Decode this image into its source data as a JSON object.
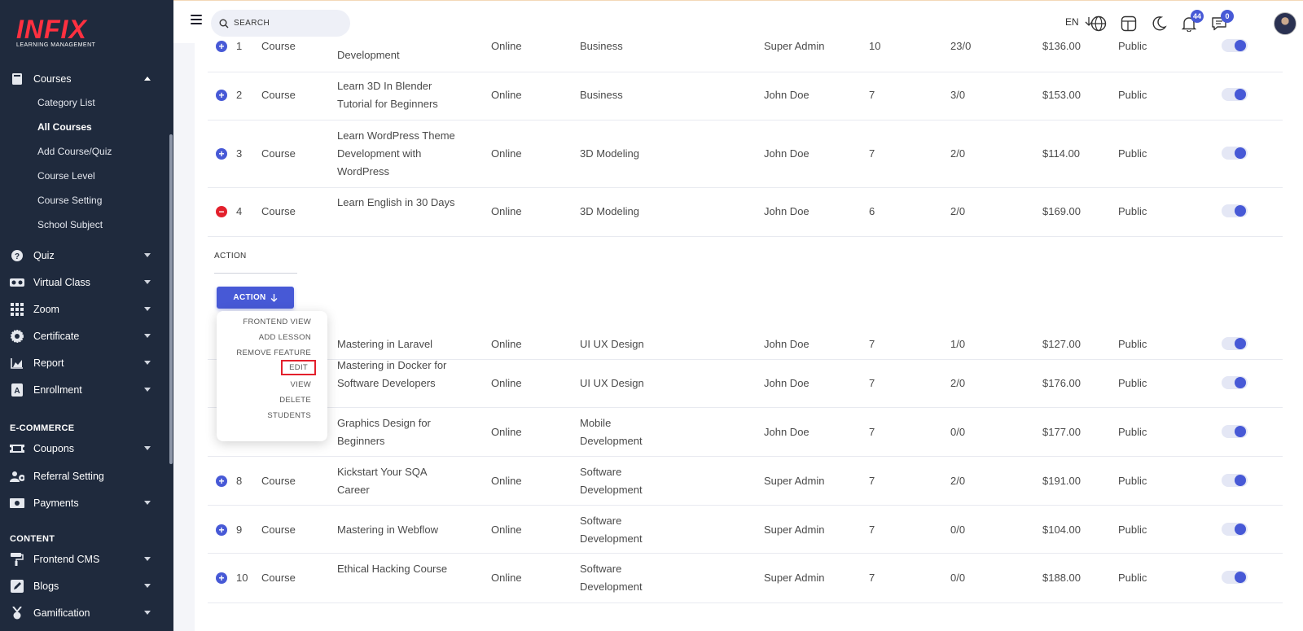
{
  "brand": {
    "logo": "INFIX",
    "subtitle": "LEARNING MANAGEMENT",
    "accent": "#4759d6",
    "danger": "#e3202c"
  },
  "header": {
    "search_placeholder": "SEARCH",
    "lang": "EN",
    "notifications_count": "44",
    "messages_count": "0"
  },
  "sidebar": {
    "courses": {
      "label": "Courses",
      "subitems": [
        "Category List",
        "All Courses",
        "Add Course/Quiz",
        "Course Level",
        "Course Setting",
        "School Subject"
      ]
    },
    "items": [
      {
        "label": "Quiz",
        "icon": "question-circle-icon"
      },
      {
        "label": "Virtual Class",
        "icon": "vr-headset-icon"
      },
      {
        "label": "Zoom",
        "icon": "grid-icon"
      },
      {
        "label": "Certificate",
        "icon": "certificate-icon"
      },
      {
        "label": "Report",
        "icon": "chart-area-icon"
      },
      {
        "label": "Enrollment",
        "icon": "enrollment-icon"
      }
    ],
    "ecommerce_heading": "E-COMMERCE",
    "ecommerce": [
      {
        "label": "Coupons",
        "icon": "ticket-icon"
      },
      {
        "label": "Referral Setting",
        "icon": "users-cog-icon"
      },
      {
        "label": "Payments",
        "icon": "money-icon"
      }
    ],
    "content_heading": "CONTENT",
    "content": [
      {
        "label": "Frontend CMS",
        "icon": "paint-roller-icon"
      },
      {
        "label": "Blogs",
        "icon": "pen-square-icon"
      },
      {
        "label": "Gamification",
        "icon": "medal-icon"
      }
    ]
  },
  "table": {
    "rows": [
      {
        "num": "1",
        "type": "Course",
        "title": "Development",
        "mode": "Online",
        "category": "Business",
        "instructor": "Super Admin",
        "lessons": "10",
        "enrolled": "23/0",
        "price": "$136.00",
        "visibility": "Public"
      },
      {
        "num": "2",
        "type": "Course",
        "title": "Learn 3D In Blender Tutorial for Beginners",
        "mode": "Online",
        "category": "Business",
        "instructor": "John Doe",
        "lessons": "7",
        "enrolled": "3/0",
        "price": "$153.00",
        "visibility": "Public"
      },
      {
        "num": "3",
        "type": "Course",
        "title": "Learn WordPress Theme Development with WordPress",
        "mode": "Online",
        "category": "3D Modeling",
        "instructor": "John Doe",
        "lessons": "7",
        "enrolled": "2/0",
        "price": "$114.00",
        "visibility": "Public"
      },
      {
        "num": "4",
        "type": "Course",
        "title": "Learn English in 30 Days",
        "mode": "Online",
        "category": "3D Modeling",
        "instructor": "John Doe",
        "lessons": "6",
        "enrolled": "2/0",
        "price": "$169.00",
        "visibility": "Public"
      },
      {
        "num": "",
        "type": "",
        "title": "Mastering in Laravel",
        "mode": "Online",
        "category": "UI UX Design",
        "instructor": "John Doe",
        "lessons": "7",
        "enrolled": "1/0",
        "price": "$127.00",
        "visibility": "Public"
      },
      {
        "num": "",
        "type": "",
        "title": "Mastering in Docker for Software Developers",
        "mode": "Online",
        "category": "UI UX Design",
        "instructor": "John Doe",
        "lessons": "7",
        "enrolled": "2/0",
        "price": "$176.00",
        "visibility": "Public"
      },
      {
        "num": "",
        "type": "",
        "title": "Graphics Design for Beginners",
        "mode": "Online",
        "category": "Mobile Development",
        "instructor": "John Doe",
        "lessons": "7",
        "enrolled": "0/0",
        "price": "$177.00",
        "visibility": "Public"
      },
      {
        "num": "8",
        "type": "Course",
        "title": "Kickstart Your SQA Career",
        "mode": "Online",
        "category": "Software Development",
        "instructor": "Super Admin",
        "lessons": "7",
        "enrolled": "2/0",
        "price": "$191.00",
        "visibility": "Public"
      },
      {
        "num": "9",
        "type": "Course",
        "title": "Mastering in Webflow",
        "mode": "Online",
        "category": "Software Development",
        "instructor": "Super Admin",
        "lessons": "7",
        "enrolled": "0/0",
        "price": "$104.00",
        "visibility": "Public"
      },
      {
        "num": "10",
        "type": "Course",
        "title": "Ethical Hacking Course",
        "mode": "Online",
        "category": "Software Development",
        "instructor": "Super Admin",
        "lessons": "7",
        "enrolled": "0/0",
        "price": "$188.00",
        "visibility": "Public"
      }
    ],
    "expanded": {
      "label": "ACTION",
      "button": "ACTION"
    }
  },
  "action_menu": [
    "FRONTEND VIEW",
    "ADD LESSON",
    "REMOVE FEATURE",
    "EDIT",
    "VIEW",
    "DELETE",
    "STUDENTS"
  ]
}
